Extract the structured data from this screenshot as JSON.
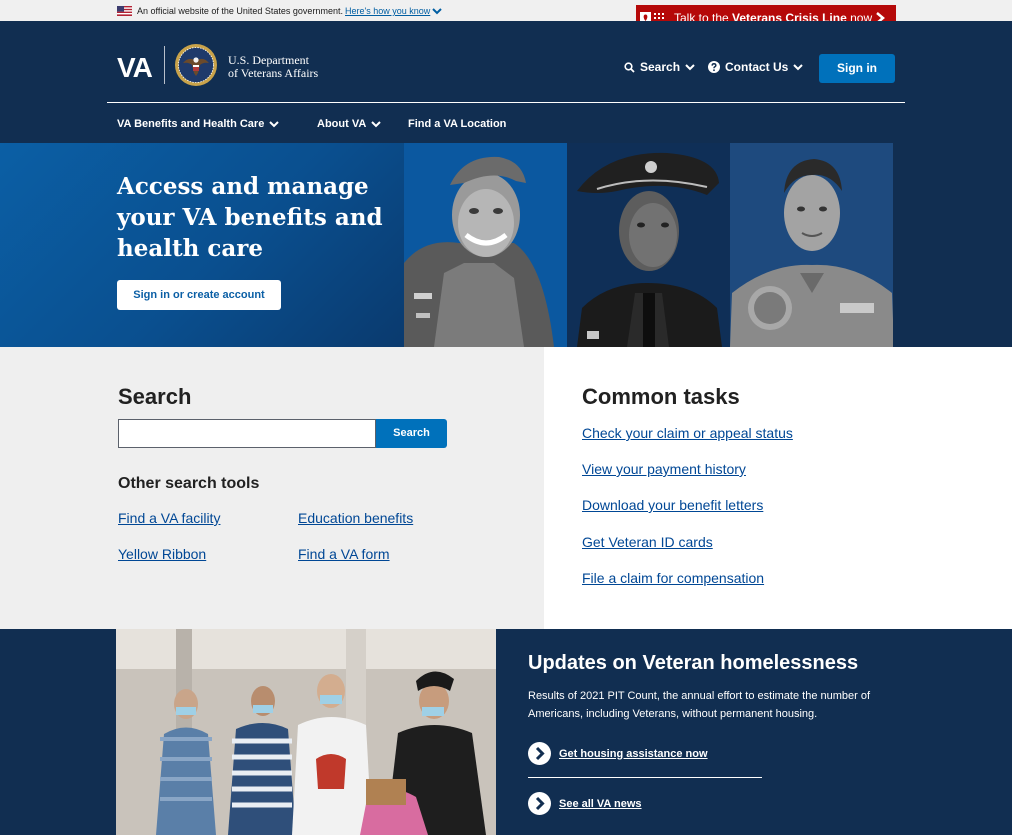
{
  "banner": {
    "official_text": "An official website of the United States government.",
    "how_you_know": "Here's how you know"
  },
  "crisis": {
    "prefix": "Talk to the ",
    "bold": "Veterans Crisis Line",
    "suffix": " now"
  },
  "header": {
    "logo_va": "VA",
    "dept_line1": "U.S. Department",
    "dept_line2": "of Veterans Affairs",
    "search_label": "Search",
    "contact_label": "Contact Us",
    "signin_label": "Sign in",
    "menu": [
      {
        "label": "VA Benefits and Health Care"
      },
      {
        "label": "About VA"
      },
      {
        "label": "Find a VA Location"
      }
    ]
  },
  "hero": {
    "title": "Access and manage your VA benefits and health care",
    "button": "Sign in or create account"
  },
  "search": {
    "heading": "Search",
    "input_value": "",
    "button": "Search",
    "tools_heading": "Other search tools",
    "tools": [
      {
        "label": "Find a VA facility"
      },
      {
        "label": "Education benefits"
      },
      {
        "label": "Yellow Ribbon"
      },
      {
        "label": "Find a VA form"
      }
    ]
  },
  "tasks": {
    "heading": "Common tasks",
    "items": [
      {
        "label": "Check your claim or appeal status"
      },
      {
        "label": "View your payment history"
      },
      {
        "label": "Download your benefit letters"
      },
      {
        "label": "Get Veteran ID cards"
      },
      {
        "label": "File a claim for compensation"
      }
    ]
  },
  "updates": {
    "title": "Updates on Veteran homelessness",
    "description": "Results of 2021 PIT Count, the annual effort to estimate the number of Americans, including Veterans, without permanent housing.",
    "link1": "Get housing assistance now",
    "link2": "See all VA news"
  },
  "colors": {
    "navy": "#112e51",
    "hero_blue": "#0b5fa5",
    "primary": "#0071bb",
    "link": "#004795",
    "crisis_red": "#b50909",
    "light_gray": "#efefef"
  },
  "icons": [
    "us-flag-icon",
    "chevron-down-icon",
    "crisis-phone-icon",
    "chevron-right-icon",
    "va-seal-icon",
    "search-icon",
    "question-circle-icon",
    "arrow-circle-right-icon"
  ]
}
